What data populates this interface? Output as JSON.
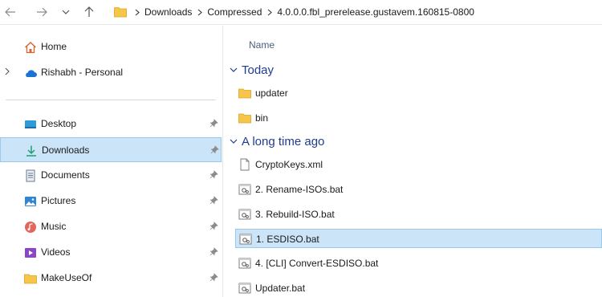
{
  "breadcrumb": [
    "Downloads",
    "Compressed",
    "4.0.0.0.fbl_prerelease.gustavem.160815-0800"
  ],
  "navigation_pane": {
    "items": [
      {
        "label": "Home",
        "icon": "home-icon"
      },
      {
        "label": "Rishabh - Personal",
        "icon": "onedrive-cloud-icon",
        "expandable": true
      }
    ],
    "quick_access": [
      {
        "label": "Desktop",
        "icon": "desktop-icon",
        "pinned": true
      },
      {
        "label": "Downloads",
        "icon": "downloads-icon",
        "pinned": true,
        "selected": true
      },
      {
        "label": "Documents",
        "icon": "documents-icon",
        "pinned": true
      },
      {
        "label": "Pictures",
        "icon": "pictures-icon",
        "pinned": true
      },
      {
        "label": "Music",
        "icon": "music-icon",
        "pinned": true
      },
      {
        "label": "Videos",
        "icon": "videos-icon",
        "pinned": true
      },
      {
        "label": "MakeUseOf",
        "icon": "folder-icon",
        "pinned": true
      }
    ]
  },
  "file_list": {
    "column_header": "Name",
    "groups": [
      {
        "title": "Today",
        "items": [
          {
            "name": "updater",
            "type": "folder"
          },
          {
            "name": "bin",
            "type": "folder"
          }
        ]
      },
      {
        "title": "A long time ago",
        "items": [
          {
            "name": "CryptoKeys.xml",
            "type": "file"
          },
          {
            "name": "2. Rename-ISOs.bat",
            "type": "batch"
          },
          {
            "name": "3. Rebuild-ISO.bat",
            "type": "batch"
          },
          {
            "name": "1. ESDISO.bat",
            "type": "batch",
            "selected": true
          },
          {
            "name": "4. [CLI] Convert-ESDISO.bat",
            "type": "batch"
          },
          {
            "name": "Updater.bat",
            "type": "batch"
          }
        ]
      }
    ]
  },
  "colors": {
    "selection_fill": "#cce4f7",
    "selection_border": "#99c9ef",
    "group_header": "#1e3d8f",
    "folder_yellow": "#f7c54a"
  }
}
